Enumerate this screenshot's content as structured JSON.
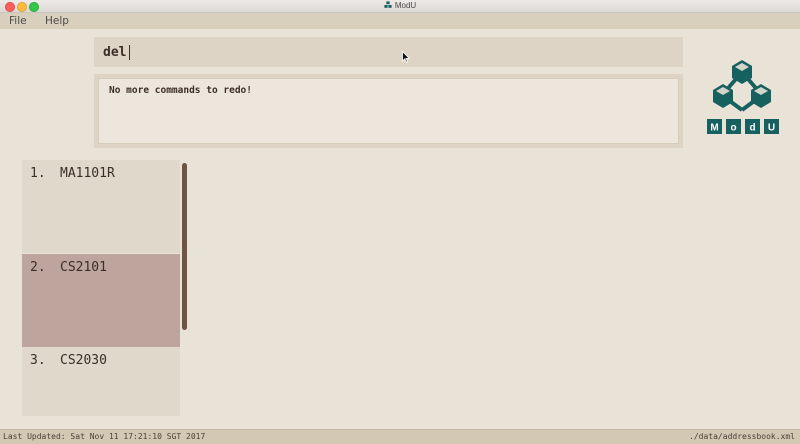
{
  "window": {
    "title": "ModU"
  },
  "menu": {
    "file": "File",
    "help": "Help"
  },
  "command": {
    "value": "del"
  },
  "result": {
    "message": "No more commands to redo!"
  },
  "logo": {
    "letters": [
      "M",
      "o",
      "d",
      "U"
    ],
    "color": "#176060"
  },
  "modules": [
    {
      "index": "1.",
      "code": "MA1101R",
      "selected": false
    },
    {
      "index": "2.",
      "code": "CS2101",
      "selected": true
    },
    {
      "index": "3.",
      "code": "CS2030",
      "selected": false
    }
  ],
  "status": {
    "last_updated": "Last Updated: Sat Nov 11 17:21:10 SGT 2017",
    "save_location": "./data/addressbook.xml"
  },
  "colors": {
    "background": "#e9e2d6",
    "panel": "#ddd4c5",
    "selected_item": "#bda49c",
    "scroll_thumb": "#6e5445",
    "brand_teal": "#176060"
  }
}
